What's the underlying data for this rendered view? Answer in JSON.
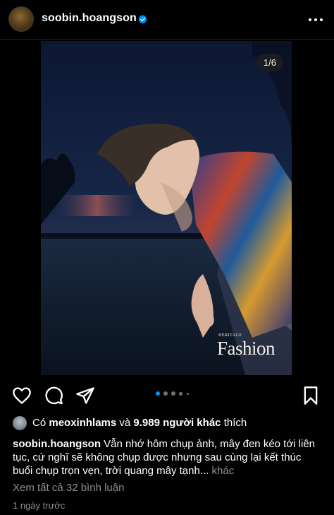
{
  "post": {
    "username": "soobin.hoangson",
    "verified": true,
    "more_icon": "more-horizontal-icon",
    "media": {
      "counter": "1/6",
      "brand_top": "HERITAGE",
      "brand": "Fashion",
      "carousel_count": 6,
      "carousel_active": 0
    },
    "actions": {
      "like_icon": "heart-icon",
      "comment_icon": "comment-icon",
      "share_icon": "send-icon",
      "save_icon": "bookmark-icon"
    },
    "likes": {
      "prefix": "Có",
      "liker": "meoxinhlams",
      "and": "và",
      "others": "9.989 người khác",
      "suffix": "thích"
    },
    "caption": {
      "author": "soobin.hoangson",
      "text": "Vẫn nhớ hôm chụp ảnh, mây đen kéo tới liên tục, cứ nghĩ sẽ không chụp được nhưng sau cùng lại kết thúc buổi chụp trọn vẹn, trời quang mây tạnh...",
      "more": "khác"
    },
    "view_comments": "Xem tất cả 32 bình luận",
    "timestamp": "1 ngày trước"
  },
  "colors": {
    "background": "#000000",
    "text": "#ffffff",
    "secondary": "#8e8e8e",
    "verified": "#0095f6",
    "dot_active": "#0095f6",
    "dot_inactive": "#737373"
  }
}
